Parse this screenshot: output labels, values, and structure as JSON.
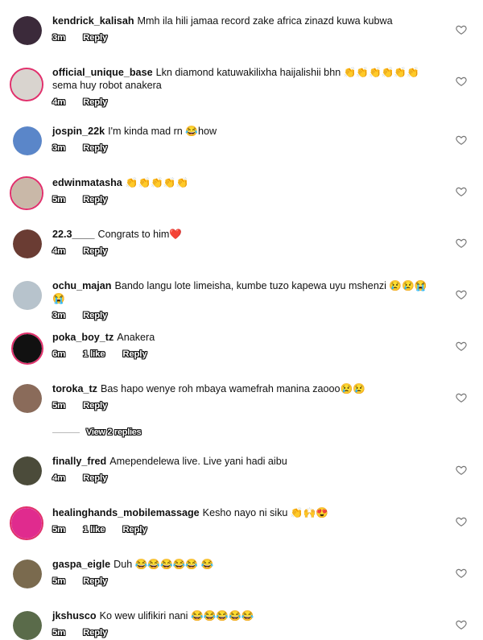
{
  "comments": [
    {
      "username": "kendrick_kalisah",
      "text": "Mmh ila hili jamaa record zake africa zinazd kuwa kubwa",
      "time": "3m",
      "likes": "",
      "reply": "Reply",
      "avatar_color": "#3b2a3a"
    },
    {
      "username": "official_unique_base",
      "text": "Lkn diamond katuwakilixha haijalishii bhn 👏👏👏👏👏👏 sema huy robot anakera",
      "time": "4m",
      "likes": "",
      "reply": "Reply",
      "avatar_color": "#d9d4cf"
    },
    {
      "username": "jospin_22k",
      "text": "I'm kinda mad rn 😂how",
      "time": "3m",
      "likes": "",
      "reply": "Reply",
      "avatar_color": "#5a86c9"
    },
    {
      "username": "edwinmatasha",
      "text": "👏👏👏👏👏",
      "time": "5m",
      "likes": "",
      "reply": "Reply",
      "avatar_color": "#c9b8a8"
    },
    {
      "username": "22.3____",
      "text": "Congrats to him❤️",
      "time": "4m",
      "likes": "",
      "reply": "Reply",
      "avatar_color": "#6a3c33"
    },
    {
      "username": "ochu_majan",
      "text": "Bando langu lote limeisha, kumbe tuzo kapewa uyu mshenzi 😢😢😭😭",
      "time": "3m",
      "likes": "",
      "reply": "Reply",
      "avatar_color": "#b7c3cc"
    },
    {
      "username": "poka_boy_tz",
      "text": "Anakera",
      "time": "6m",
      "likes": "1 like",
      "reply": "Reply",
      "avatar_color": "#111111"
    },
    {
      "username": "toroka_tz",
      "text": "Bas hapo wenye roh mbaya wamefrah manina zaooo😢😢",
      "time": "5m",
      "likes": "",
      "reply": "Reply",
      "avatar_color": "#8a6b5a"
    },
    {
      "username": "finally_fred",
      "text": "Amependelewa live. Live yani hadi aibu",
      "time": "4m",
      "likes": "",
      "reply": "Reply",
      "avatar_color": "#4b4b3a"
    },
    {
      "username": "healinghands_mobilemassage",
      "text": "Kesho nayo ni siku 👏🙌😍",
      "time": "5m",
      "likes": "1 like",
      "reply": "Reply",
      "avatar_color": "#e02b8e"
    },
    {
      "username": "gaspa_eigle",
      "text": "Duh 😂😂😂😂😂 😂",
      "time": "5m",
      "likes": "",
      "reply": "Reply",
      "avatar_color": "#7a6a4e"
    },
    {
      "username": "jkshusco",
      "text": "Ko wew ulifikiri nani 😂😂😂😂😂",
      "time": "5m",
      "likes": "",
      "reply": "Reply",
      "avatar_color": "#5a6b4a"
    }
  ],
  "view_replies": "View 2 replies"
}
